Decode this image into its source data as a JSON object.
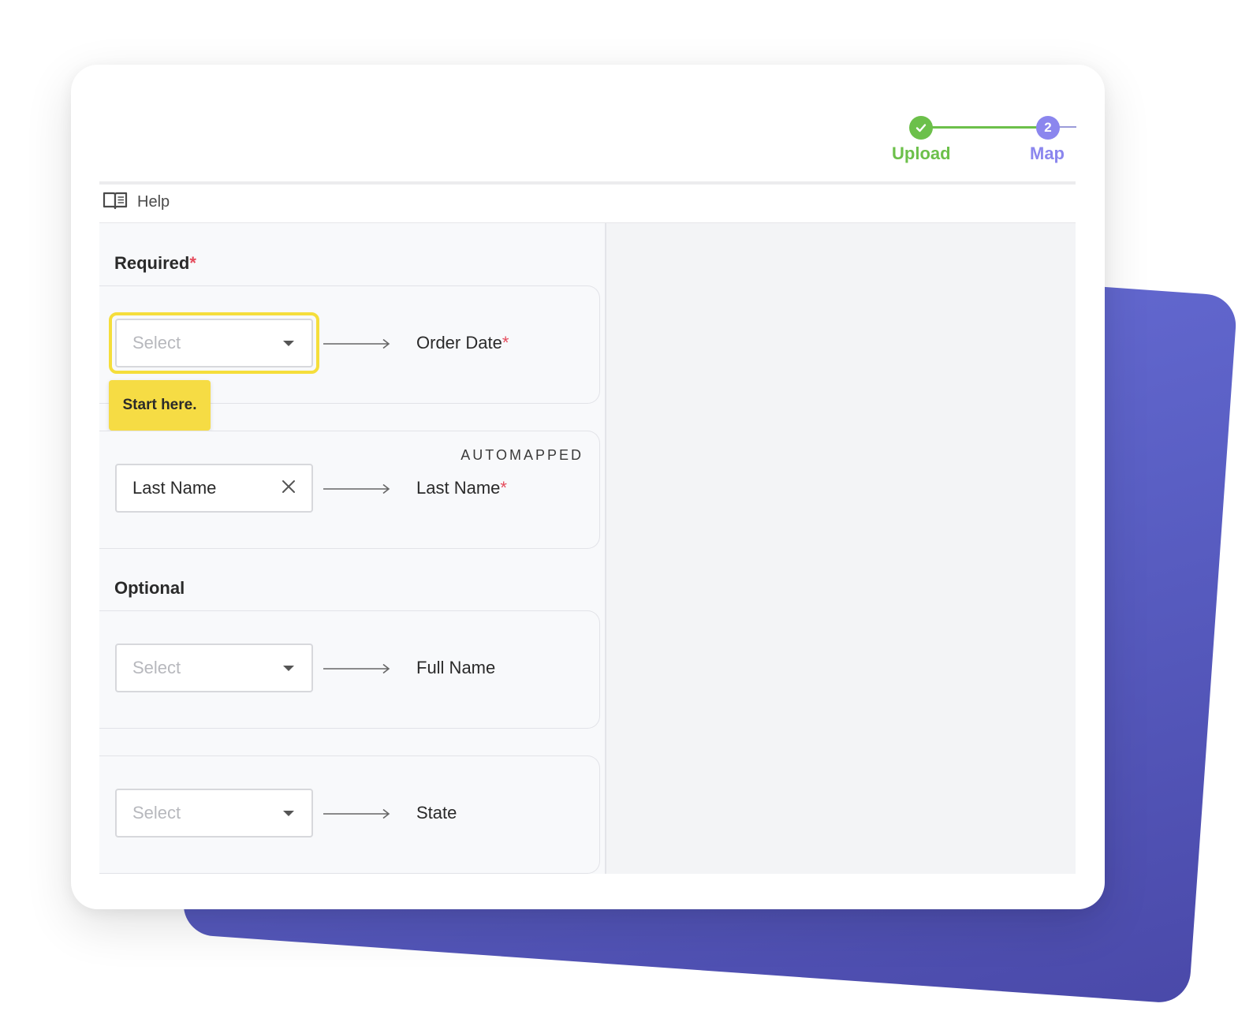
{
  "stepper": {
    "steps": [
      {
        "label": "Upload",
        "state": "complete",
        "color": "#6cc04a"
      },
      {
        "label": "Map",
        "number": "2",
        "state": "current",
        "color": "#8b86ee"
      }
    ]
  },
  "help": {
    "label": "Help"
  },
  "required": {
    "title": "Required",
    "star": "*",
    "rows": [
      {
        "select_placeholder": "Select",
        "field": "Order Date",
        "required_mark": "*"
      },
      {
        "select_value": "Last Name",
        "badge": "AUTOMAPPED",
        "field": "Last Name",
        "required_mark": "*"
      }
    ]
  },
  "tooltip": {
    "text": "Start here."
  },
  "optional": {
    "title": "Optional",
    "rows": [
      {
        "select_placeholder": "Select",
        "field": "Full Name"
      },
      {
        "select_placeholder": "Select",
        "field": "State"
      }
    ]
  },
  "colors": {
    "accent_green": "#6cc04a",
    "accent_purple": "#8b86ee",
    "highlight_yellow": "#f5de3b",
    "backdrop": "#5a5fc4"
  }
}
